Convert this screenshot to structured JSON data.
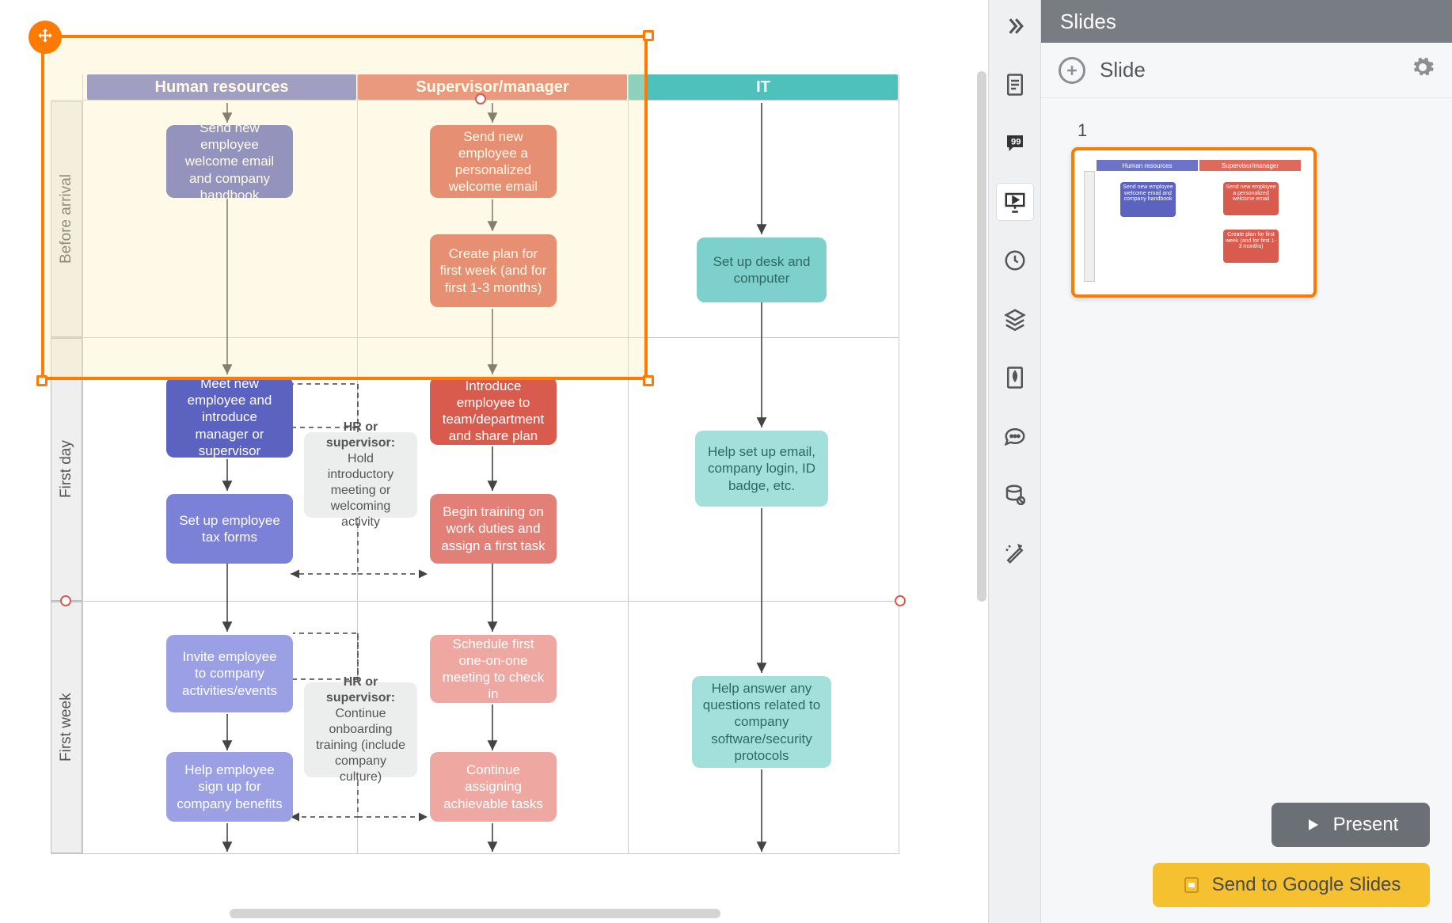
{
  "panel": {
    "title": "Slides",
    "add_label": "Slide",
    "slide_number": "1",
    "present_label": "Present",
    "gslides_label": "Send to Google Slides"
  },
  "columns": {
    "hr": "Human resources",
    "sup": "Supervisor/manager",
    "it": "IT"
  },
  "lanes": {
    "before": "Before arrival",
    "first_day": "First day",
    "first_week": "First week"
  },
  "nodes": {
    "hr_before": "Send new employee welcome email and company handbook",
    "sup_before1": "Send new employee a personalized welcome email",
    "sup_before2": "Create plan for first week (and for first 1-3 months)",
    "it_before": "Set up desk and computer",
    "hr_day1": "Meet new employee and introduce manager or supervisor",
    "hr_day2": "Set up employee tax forms",
    "mid_day_bold": "HR or supervisor:",
    "mid_day_rest": " Hold introductory meeting or welcoming activity",
    "sup_day1": "Introduce employee to team/department and share plan",
    "sup_day2": "Begin training on work duties and assign a first task",
    "it_day": "Help set up email, company login, ID badge, etc.",
    "hr_week1": "Invite employee to company activities/events",
    "hr_week2": "Help employee sign up for company benefits",
    "mid_week_bold": "HR or supervisor:",
    "mid_week_rest": " Continue onboarding training (include company culture)",
    "sup_week1": "Schedule first one-on-one meeting to check in",
    "sup_week2": "Continue assigning achievable tasks",
    "it_week": "Help answer any questions related to company software/security protocols"
  },
  "toolstrip": {
    "collapse": "collapse-panel",
    "settings": "settings",
    "comments": "comments",
    "presentation": "presentation",
    "history": "history",
    "layers": "layers",
    "theme": "theme",
    "chat": "chat",
    "data": "data",
    "magic": "magic"
  }
}
